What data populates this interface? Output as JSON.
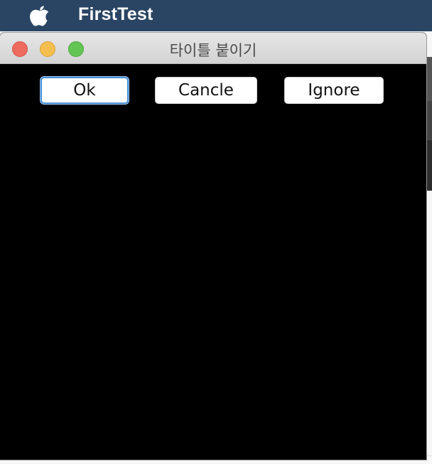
{
  "menubar": {
    "app_name": "FirstTest",
    "apple_icon": "apple-logo-icon"
  },
  "window": {
    "title": "타이틀 붙이기",
    "traffic_lights": {
      "close_color": "#ed6a5e",
      "minimize_color": "#f5bf4f",
      "zoom_color": "#62c554"
    },
    "content_background": "#000000",
    "buttons": [
      {
        "label": "Ok",
        "focused": true
      },
      {
        "label": "Cancle",
        "focused": false
      },
      {
        "label": "Ignore",
        "focused": false
      }
    ]
  },
  "colors": {
    "menubar_bg": "#2a4563",
    "focus_ring": "#4a8fd6"
  }
}
